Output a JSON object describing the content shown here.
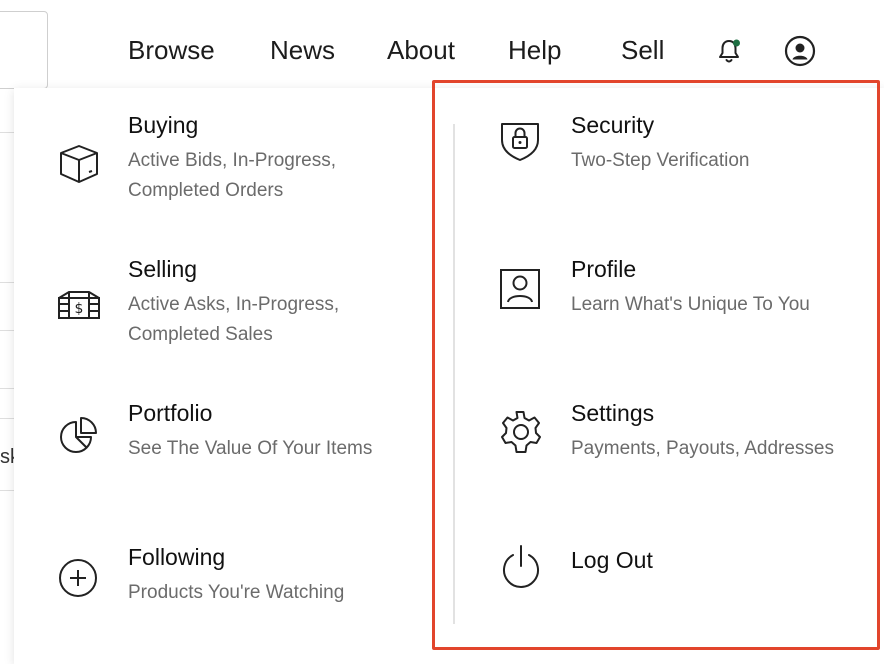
{
  "nav": {
    "links": [
      {
        "label": "Browse"
      },
      {
        "label": "News"
      },
      {
        "label": "About"
      },
      {
        "label": "Help"
      },
      {
        "label": "Sell"
      }
    ],
    "icons": {
      "notifications": "bell-icon",
      "account": "user-circle-icon"
    },
    "notification_dot_color": "#1f6f43"
  },
  "background": {
    "fragment_text": "sk"
  },
  "menu": {
    "left": [
      {
        "title": "Buying",
        "desc_lines": [
          "Active Bids, In-Progress,",
          "Completed Orders"
        ],
        "icon": "box-icon"
      },
      {
        "title": "Selling",
        "desc_lines": [
          "Active Asks, In-Progress,",
          "Completed Sales"
        ],
        "icon": "cash-register-icon"
      },
      {
        "title": "Portfolio",
        "desc_lines": [
          "See The Value Of Your Items"
        ],
        "icon": "pie-chart-icon"
      },
      {
        "title": "Following",
        "desc_lines": [
          "Products You're Watching"
        ],
        "icon": "plus-circle-icon"
      }
    ],
    "right": [
      {
        "title": "Security",
        "desc_lines": [
          "Two-Step Verification"
        ],
        "icon": "shield-lock-icon"
      },
      {
        "title": "Profile",
        "desc_lines": [
          "Learn What's Unique To You"
        ],
        "icon": "profile-card-icon"
      },
      {
        "title": "Settings",
        "desc_lines": [
          "Payments, Payouts, Addresses"
        ],
        "icon": "gear-icon"
      },
      {
        "title": "Log Out",
        "desc_lines": [],
        "icon": "power-icon"
      }
    ]
  },
  "annotation": {
    "highlight_color": "#e2452c"
  }
}
